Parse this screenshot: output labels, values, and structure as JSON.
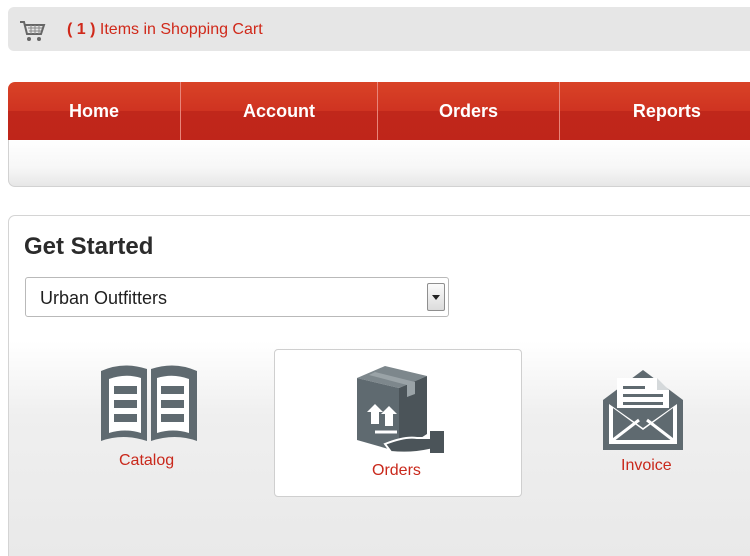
{
  "cart": {
    "count_text": "( 1 )",
    "label": "Items in Shopping Cart",
    "icon": "shopping-cart-icon"
  },
  "nav": {
    "items": [
      {
        "label": "Home"
      },
      {
        "label": "Account"
      },
      {
        "label": "Orders"
      },
      {
        "label": "Reports"
      }
    ]
  },
  "get_started": {
    "title": "Get Started",
    "select": {
      "value": "Urban Outfitters"
    },
    "tiles": [
      {
        "label": "Catalog",
        "icon": "book-icon"
      },
      {
        "label": "Orders",
        "icon": "package-hand-icon"
      },
      {
        "label": "Invoice",
        "icon": "envelope-document-icon"
      }
    ]
  },
  "colors": {
    "accent": "#d0291a",
    "nav_top": "#d94327",
    "nav_bottom": "#bf251a",
    "icon_gray": "#5f6a70"
  }
}
